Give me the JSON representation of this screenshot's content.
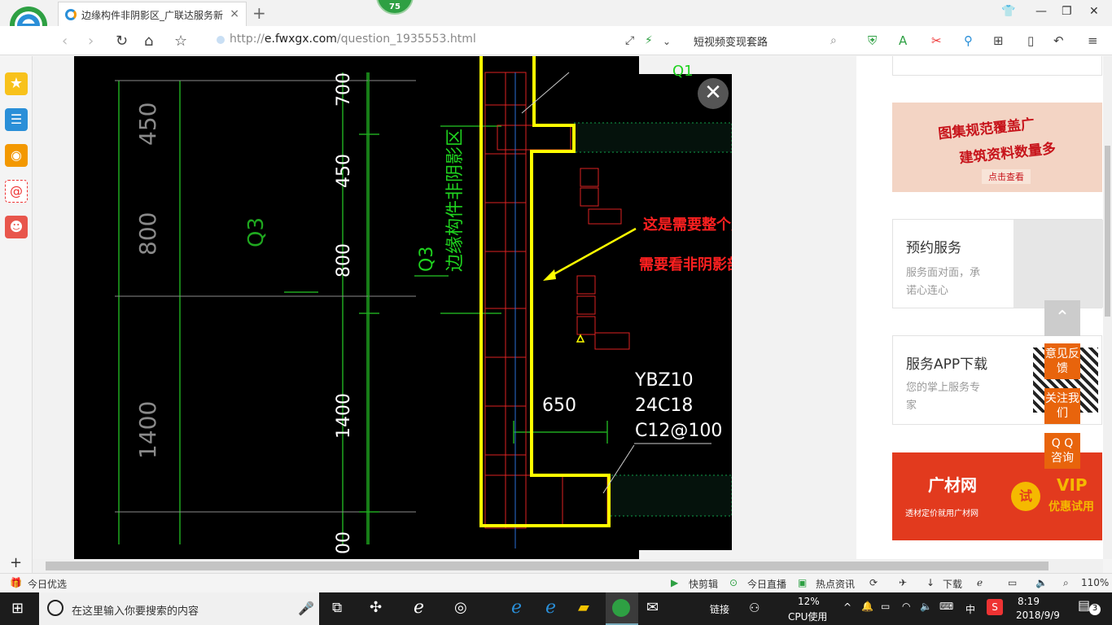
{
  "tab": {
    "title": "边缘构件非阴影区_广联达服务新",
    "close": "×",
    "new": "+"
  },
  "badge": "75",
  "address": {
    "prefix": "http://",
    "host": "e.fwxgx.com",
    "path": "/question_1935553.html"
  },
  "search": {
    "text": "短视频变现套路"
  },
  "drawing": {
    "dims_left": [
      "450",
      "800",
      "1400"
    ],
    "dims_mid": [
      "700",
      "450",
      "800",
      "1400",
      "00"
    ],
    "q3_left": "Q3",
    "q3_label": "Q3",
    "q3_zone": "边缘构件非阴影区",
    "annot_line1": "这是需要整个定义为暗柱",
    "annot_line2": "需要看非阴影部分的节点",
    "dim_650": "650",
    "ybz": "YBZ10",
    "bars": "24C18",
    "stirrup": "C12@100",
    "q_top": "Q1"
  },
  "right": {
    "ad1_line1": "图集规范覆盖广",
    "ad1_line2": "建筑资料数量多",
    "ad1_btn": "点击查看",
    "svc_title": "预约服务",
    "svc_desc1": "服务面对面，承",
    "svc_desc2": "诺心连心",
    "app_title": "服务APP下载",
    "app_desc1": "您的掌上服务专",
    "app_desc2": "家",
    "ad2_brand": "广材网",
    "ad2_sub": "透材定价就用广材网",
    "ad2_vip": "VIP",
    "ad2_vip2": "优惠试用",
    "ad2_try": "试"
  },
  "float": {
    "feedback": "意见反馈",
    "follow": "关注我们",
    "qq": "Q Q 咨询"
  },
  "statusbar": {
    "left": "今日优选",
    "items": [
      "快剪辑",
      "今日直播",
      "热点资讯",
      "下载"
    ],
    "zoom": "110%"
  },
  "taskbar": {
    "search_placeholder": "在这里输入你要搜索的内容",
    "link": "链接",
    "cpu_pct": "12%",
    "cpu_label": "CPU使用",
    "ime": "中",
    "time": "8:19",
    "date": "2018/9/9",
    "notif": "3"
  },
  "colors": {
    "accent": "#2a8fd8",
    "cad_green": "#00c800",
    "highlight": "#ffff00",
    "annot": "#ff1e1e"
  }
}
